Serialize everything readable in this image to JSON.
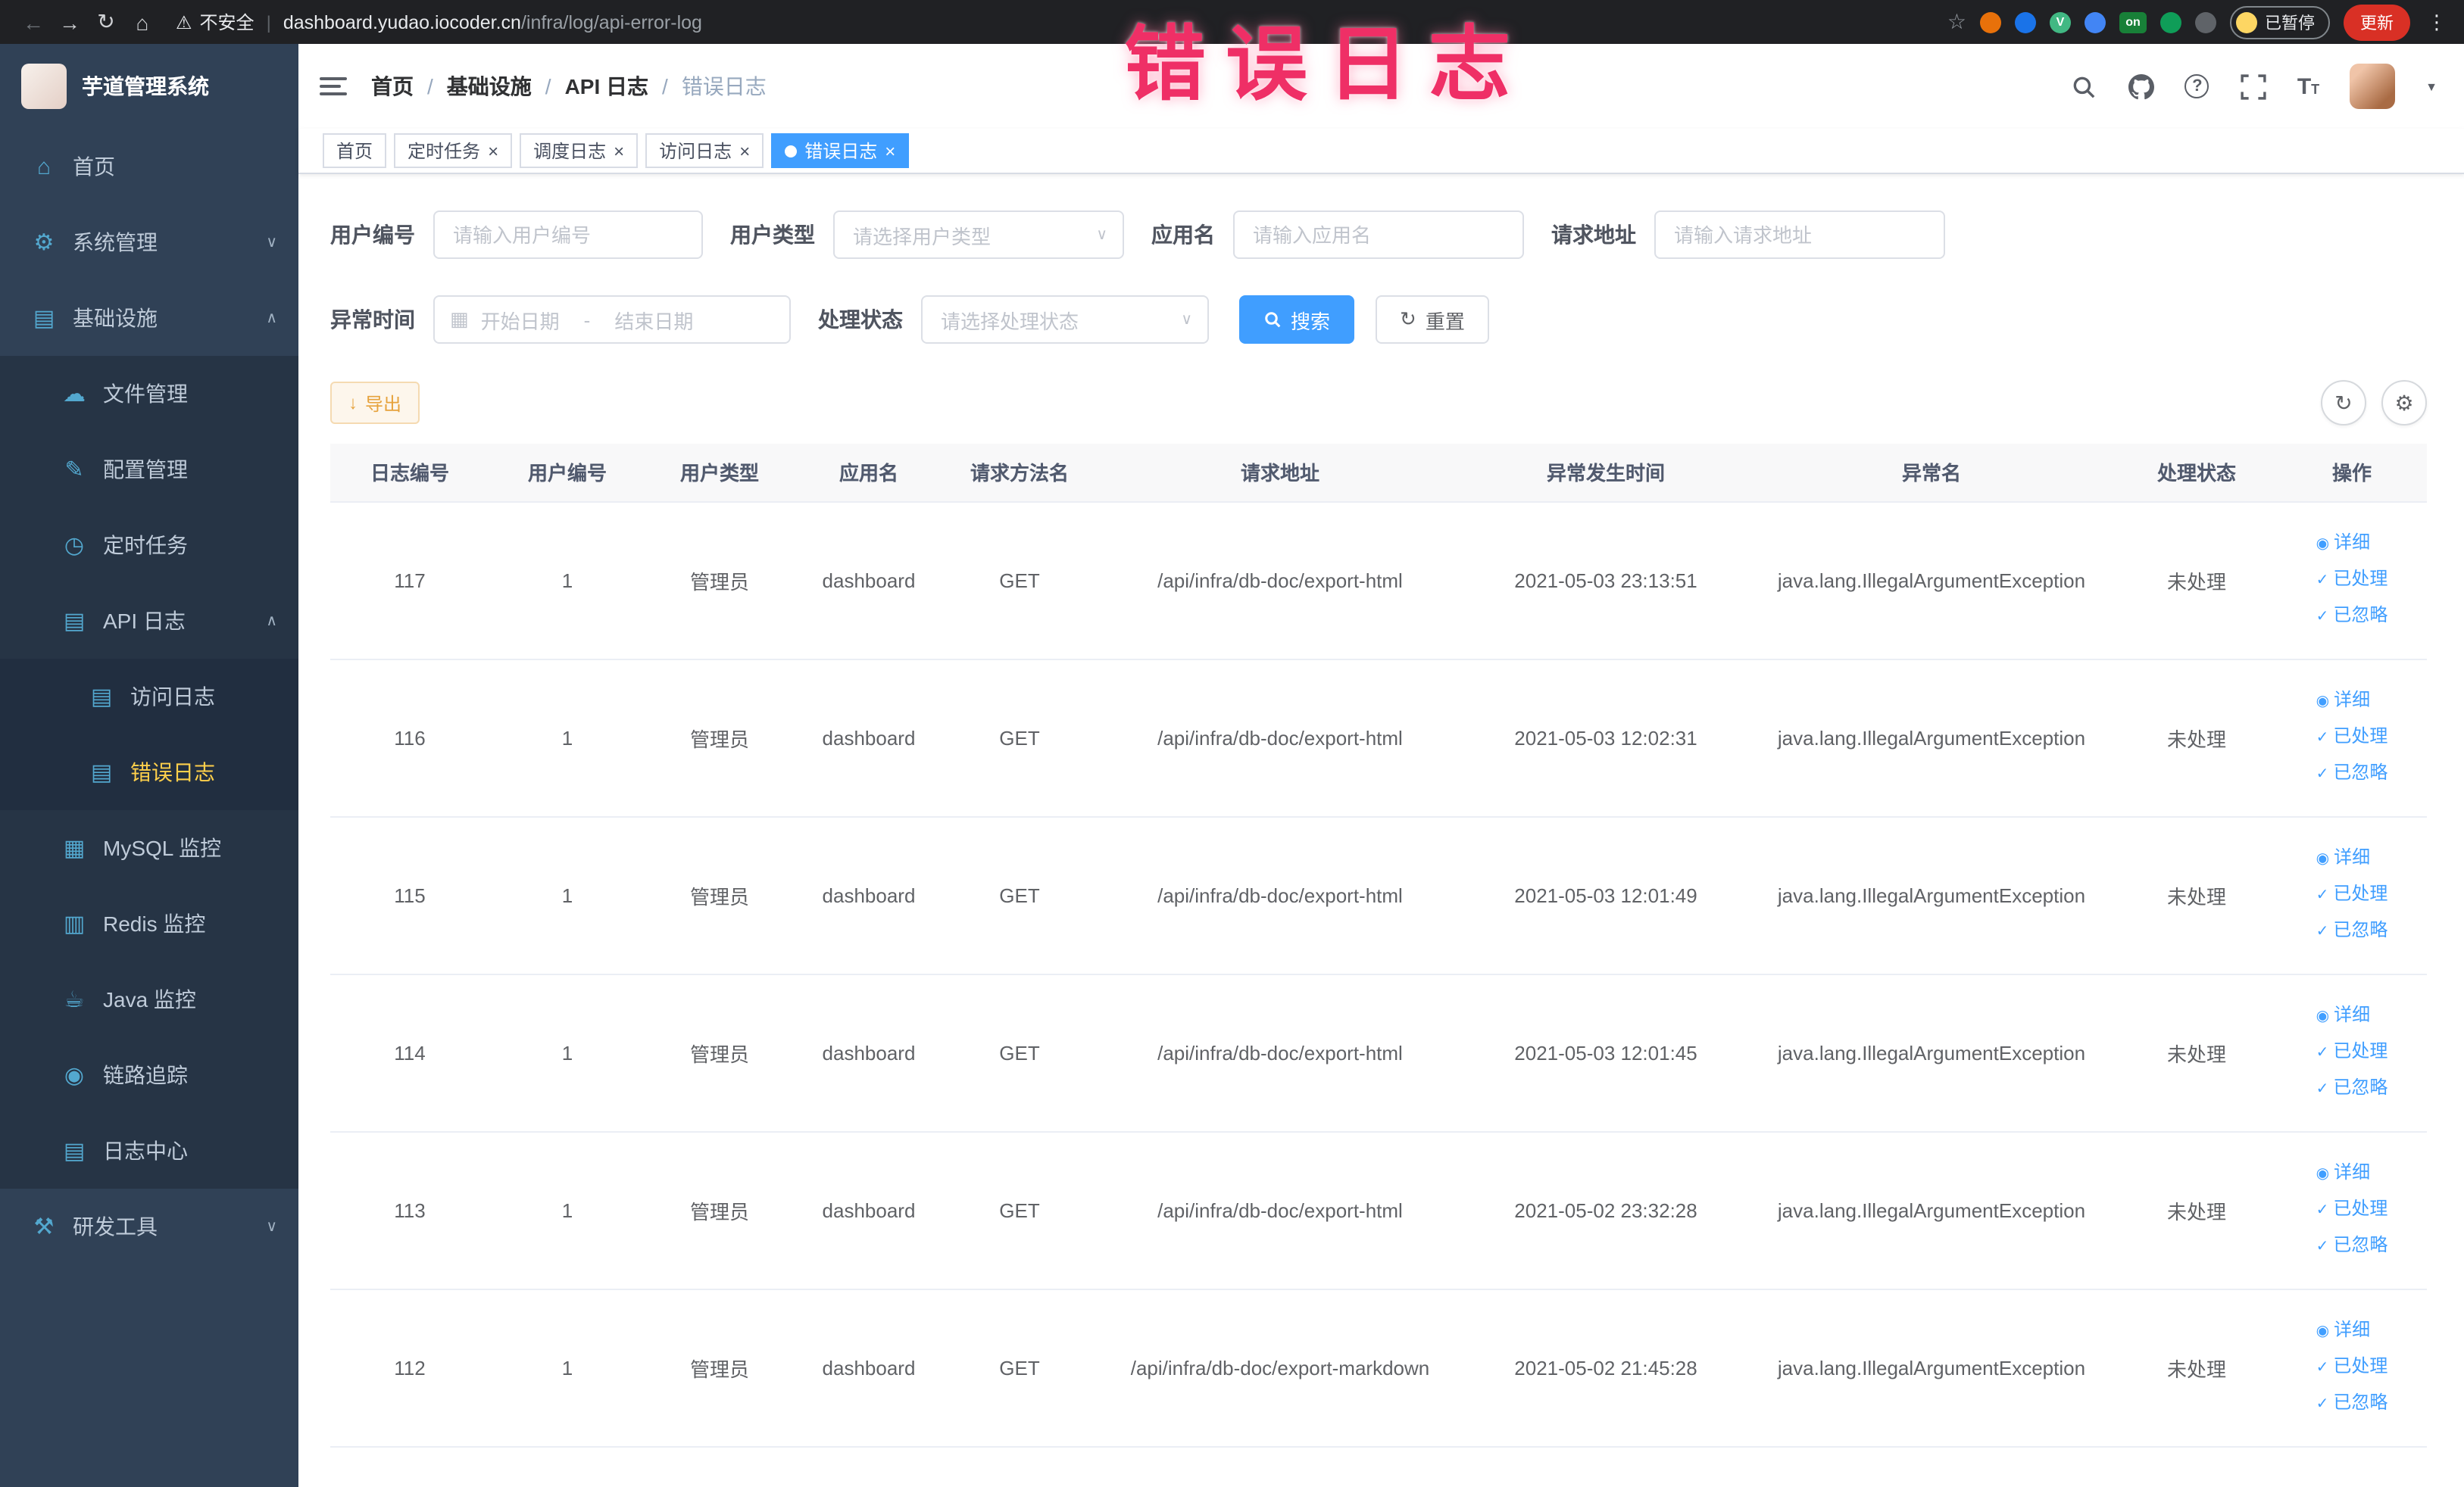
{
  "colors": {
    "accent": "#409eff",
    "warning_button": "#e6a23c",
    "sidebar_active": "#ffd04b",
    "annotation": "#ef2f66",
    "tag_active_bg": "#409eff"
  },
  "annotation": {
    "text": "错误日志"
  },
  "browser": {
    "security_label": "不安全",
    "url_domain": "dashboard.yudao.iocoder.cn",
    "url_path": "/infra/log/api-error-log",
    "paused_badge": "已暂停",
    "update_button": "更新",
    "extensions": [
      {
        "bg": "#e8710a",
        "label": ""
      },
      {
        "bg": "#1a73e8",
        "label": ""
      },
      {
        "bg": "#41b883",
        "label": "V"
      },
      {
        "bg": "#4285f4",
        "label": ""
      },
      {
        "bg": "#188038",
        "label": "on"
      },
      {
        "bg": "#0f9d58",
        "label": ""
      },
      {
        "bg": "#5f6368",
        "label": ""
      }
    ]
  },
  "icons": {
    "back": "←",
    "forward": "→",
    "reload": "↻",
    "home": "⌂",
    "warning": "⚠",
    "star": "☆",
    "more": "⋮",
    "close": "×",
    "chevron_down": "∨",
    "chevron_up": "∧",
    "caret_down": "▼",
    "menu_home": "⌂",
    "gear": "⚙",
    "infra": "▤",
    "cloud": "☁",
    "edit": "✎",
    "clock": "◷",
    "doc": "▤",
    "grid": "▦",
    "db": "▥",
    "coffee": "☕",
    "eye": "◉",
    "tools": "⚒",
    "calendar": "▦",
    "refresh": "↻",
    "download": "↓",
    "check": "✓",
    "question": "?",
    "settings": "⚙",
    "fontsize": "T"
  },
  "sidebar": {
    "logo_title": "芋道管理系统",
    "items": [
      {
        "label": "首页"
      },
      {
        "label": "系统管理"
      },
      {
        "label": "基础设施"
      },
      {
        "label": "文件管理"
      },
      {
        "label": "配置管理"
      },
      {
        "label": "定时任务"
      },
      {
        "label": "API 日志"
      },
      {
        "label": "访问日志"
      },
      {
        "label": "错误日志"
      },
      {
        "label": "MySQL 监控"
      },
      {
        "label": "Redis 监控"
      },
      {
        "label": "Java 监控"
      },
      {
        "label": "链路追踪"
      },
      {
        "label": "日志中心"
      },
      {
        "label": "研发工具"
      }
    ]
  },
  "breadcrumb": {
    "separator": "/",
    "items": [
      "首页",
      "基础设施",
      "API 日志",
      "错误日志"
    ]
  },
  "tabs": [
    {
      "label": "首页",
      "closable": false,
      "active": false
    },
    {
      "label": "定时任务",
      "closable": true,
      "active": false
    },
    {
      "label": "调度日志",
      "closable": true,
      "active": false
    },
    {
      "label": "访问日志",
      "closable": true,
      "active": false
    },
    {
      "label": "错误日志",
      "closable": true,
      "active": true
    }
  ],
  "filters": {
    "user_id": {
      "label": "用户编号",
      "placeholder": "请输入用户编号"
    },
    "user_type": {
      "label": "用户类型",
      "placeholder": "请选择用户类型"
    },
    "app_name": {
      "label": "应用名",
      "placeholder": "请输入应用名"
    },
    "request_url": {
      "label": "请求地址",
      "placeholder": "请输入请求地址"
    },
    "exception_time": {
      "label": "异常时间",
      "start_placeholder": "开始日期",
      "end_placeholder": "结束日期",
      "separator": "-"
    },
    "process_status": {
      "label": "处理状态",
      "placeholder": "请选择处理状态"
    },
    "search_button": "搜索",
    "reset_button": "重置"
  },
  "toolbar": {
    "export_button": "导出"
  },
  "table": {
    "columns": [
      "日志编号",
      "用户编号",
      "用户类型",
      "应用名",
      "请求方法名",
      "请求地址",
      "异常发生时间",
      "异常名",
      "处理状态",
      "操作"
    ],
    "actions": [
      "详细",
      "已处理",
      "已忽略"
    ],
    "rows": [
      {
        "id": "117",
        "user_id": "1",
        "user_type": "管理员",
        "app": "dashboard",
        "method": "GET",
        "url": "/api/infra/db-doc/export-html",
        "time": "2021-05-03 23:13:51",
        "exception": "java.lang.IllegalArgumentException",
        "status": "未处理"
      },
      {
        "id": "116",
        "user_id": "1",
        "user_type": "管理员",
        "app": "dashboard",
        "method": "GET",
        "url": "/api/infra/db-doc/export-html",
        "time": "2021-05-03 12:02:31",
        "exception": "java.lang.IllegalArgumentException",
        "status": "未处理"
      },
      {
        "id": "115",
        "user_id": "1",
        "user_type": "管理员",
        "app": "dashboard",
        "method": "GET",
        "url": "/api/infra/db-doc/export-html",
        "time": "2021-05-03 12:01:49",
        "exception": "java.lang.IllegalArgumentException",
        "status": "未处理"
      },
      {
        "id": "114",
        "user_id": "1",
        "user_type": "管理员",
        "app": "dashboard",
        "method": "GET",
        "url": "/api/infra/db-doc/export-html",
        "time": "2021-05-03 12:01:45",
        "exception": "java.lang.IllegalArgumentException",
        "status": "未处理"
      },
      {
        "id": "113",
        "user_id": "1",
        "user_type": "管理员",
        "app": "dashboard",
        "method": "GET",
        "url": "/api/infra/db-doc/export-html",
        "time": "2021-05-02 23:32:28",
        "exception": "java.lang.IllegalArgumentException",
        "status": "未处理"
      },
      {
        "id": "112",
        "user_id": "1",
        "user_type": "管理员",
        "app": "dashboard",
        "method": "GET",
        "url": "/api/infra/db-doc/export-markdown",
        "time": "2021-05-02 21:45:28",
        "exception": "java.lang.IllegalArgumentException",
        "status": "未处理"
      }
    ]
  }
}
